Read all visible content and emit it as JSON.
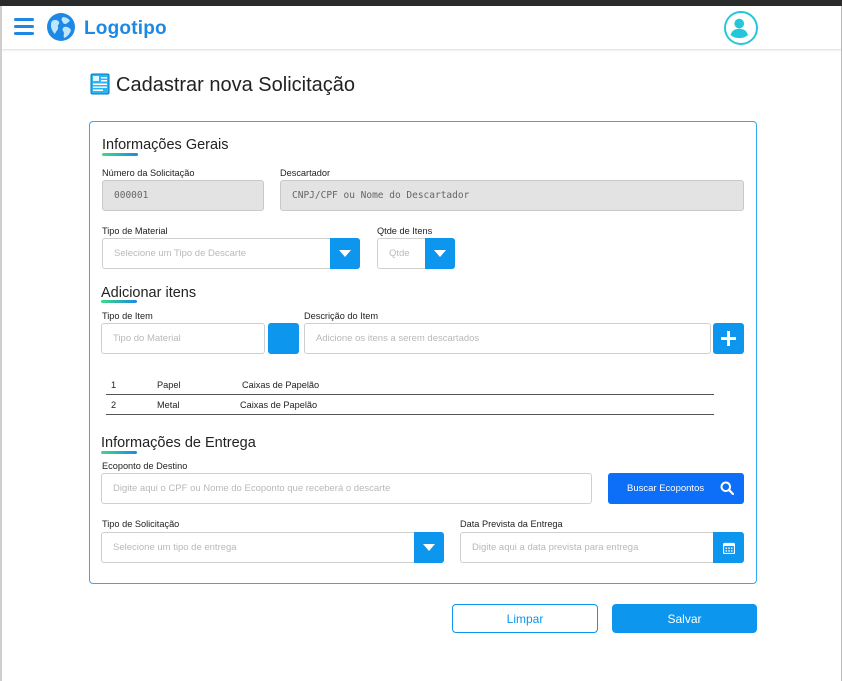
{
  "header": {
    "logo_text": "Logotipo",
    "menu_icon": "hamburger-icon",
    "logo_icon": "globe-icon",
    "avatar_icon": "user-avatar-icon"
  },
  "page": {
    "title": "Cadastrar nova Solicitação",
    "title_icon": "document-icon"
  },
  "general": {
    "title": "Informações Gerais",
    "number_label": "Número da Solicitação",
    "number_value": "000001",
    "discarder_label": "Descartador",
    "discarder_value": "CNPJ/CPF ou Nome  do Descartador",
    "material_label": "Tipo de Material",
    "material_placeholder": "Selecione um Tipo de Descarte",
    "qty_label": "Qtde de Itens",
    "qty_placeholder": "Qtde"
  },
  "items": {
    "title": "Adicionar itens",
    "type_label": "Tipo de Item",
    "type_placeholder": "Tipo do Material",
    "desc_label": "Descrição do Item",
    "desc_placeholder": "Adicione os itens a serem descartados",
    "add_icon": "plus-icon",
    "rows": [
      {
        "num": "1",
        "material": "Papel",
        "description": "Caixas de Papelão"
      },
      {
        "num": "2",
        "material": "Metal",
        "description": "Caixas de Papelão"
      }
    ]
  },
  "delivery": {
    "title": "Informações de Entrega",
    "ecopoint_label": "Ecoponto de Destino",
    "ecopoint_placeholder": "Digite aqui o CPF ou Nome do Ecoponto que receberá o descarte",
    "search_button": "Buscar Ecopontos",
    "search_icon": "search-icon",
    "request_type_label": "Tipo de Solicitação",
    "request_type_placeholder": "Selecione um tipo de entrega",
    "date_label": "Data Prevista da Entrega",
    "date_placeholder": "Digite aqui a data prevista para entrega",
    "calendar_icon": "calendar-icon"
  },
  "actions": {
    "clear": "Limpar",
    "save": "Salvar"
  },
  "colors": {
    "brand": "#1e88e5",
    "accent": "#0d96ee",
    "search_button": "#0d6ef7",
    "card_border": "#33aaf0",
    "avatar_ring": "#26c6da"
  }
}
